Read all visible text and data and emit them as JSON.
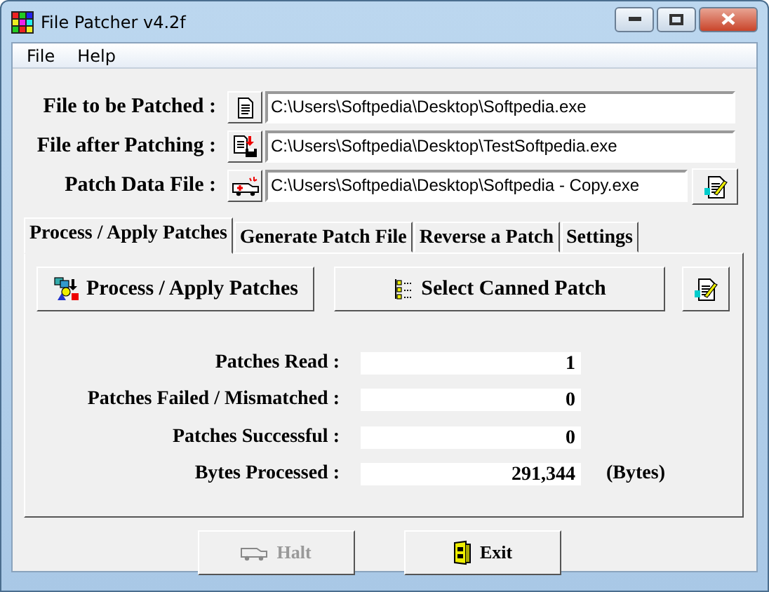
{
  "window": {
    "title": "File Patcher v4.2f"
  },
  "menu": [
    {
      "label": "File"
    },
    {
      "label": "Help"
    }
  ],
  "file_fields": [
    {
      "label": "File to be Patched :",
      "value": "C:\\Users\\Softpedia\\Desktop\\Softpedia.exe",
      "kind": "source"
    },
    {
      "label": "File after Patching :",
      "value": "C:\\Users\\Softpedia\\Desktop\\TestSoftpedia.exe",
      "kind": "target"
    },
    {
      "label": "Patch Data File :",
      "value": "C:\\Users\\Softpedia\\Desktop\\Softpedia - Copy.exe",
      "kind": "patch"
    }
  ],
  "tabs": [
    {
      "label": "Process / Apply Patches",
      "selected": true
    },
    {
      "label": "Generate Patch File",
      "selected": false
    },
    {
      "label": "Reverse a Patch",
      "selected": false
    },
    {
      "label": "Settings",
      "selected": false
    }
  ],
  "actions": [
    {
      "label": "Process / Apply Patches",
      "kind": "process"
    },
    {
      "label": "Select Canned Patch",
      "kind": "canned"
    }
  ],
  "stats": [
    {
      "label": "Patches Read :",
      "value": "1"
    },
    {
      "label": "Patches Failed / Mismatched :",
      "value": "0"
    },
    {
      "label": "Patches Successful :",
      "value": "0"
    },
    {
      "label": "Bytes Processed :",
      "value": "291,344",
      "unit": "(Bytes)"
    }
  ],
  "buttons": [
    {
      "label": "Halt",
      "disabled": true,
      "kind": "halt"
    },
    {
      "label": "Exit",
      "disabled": false,
      "kind": "exit"
    }
  ]
}
